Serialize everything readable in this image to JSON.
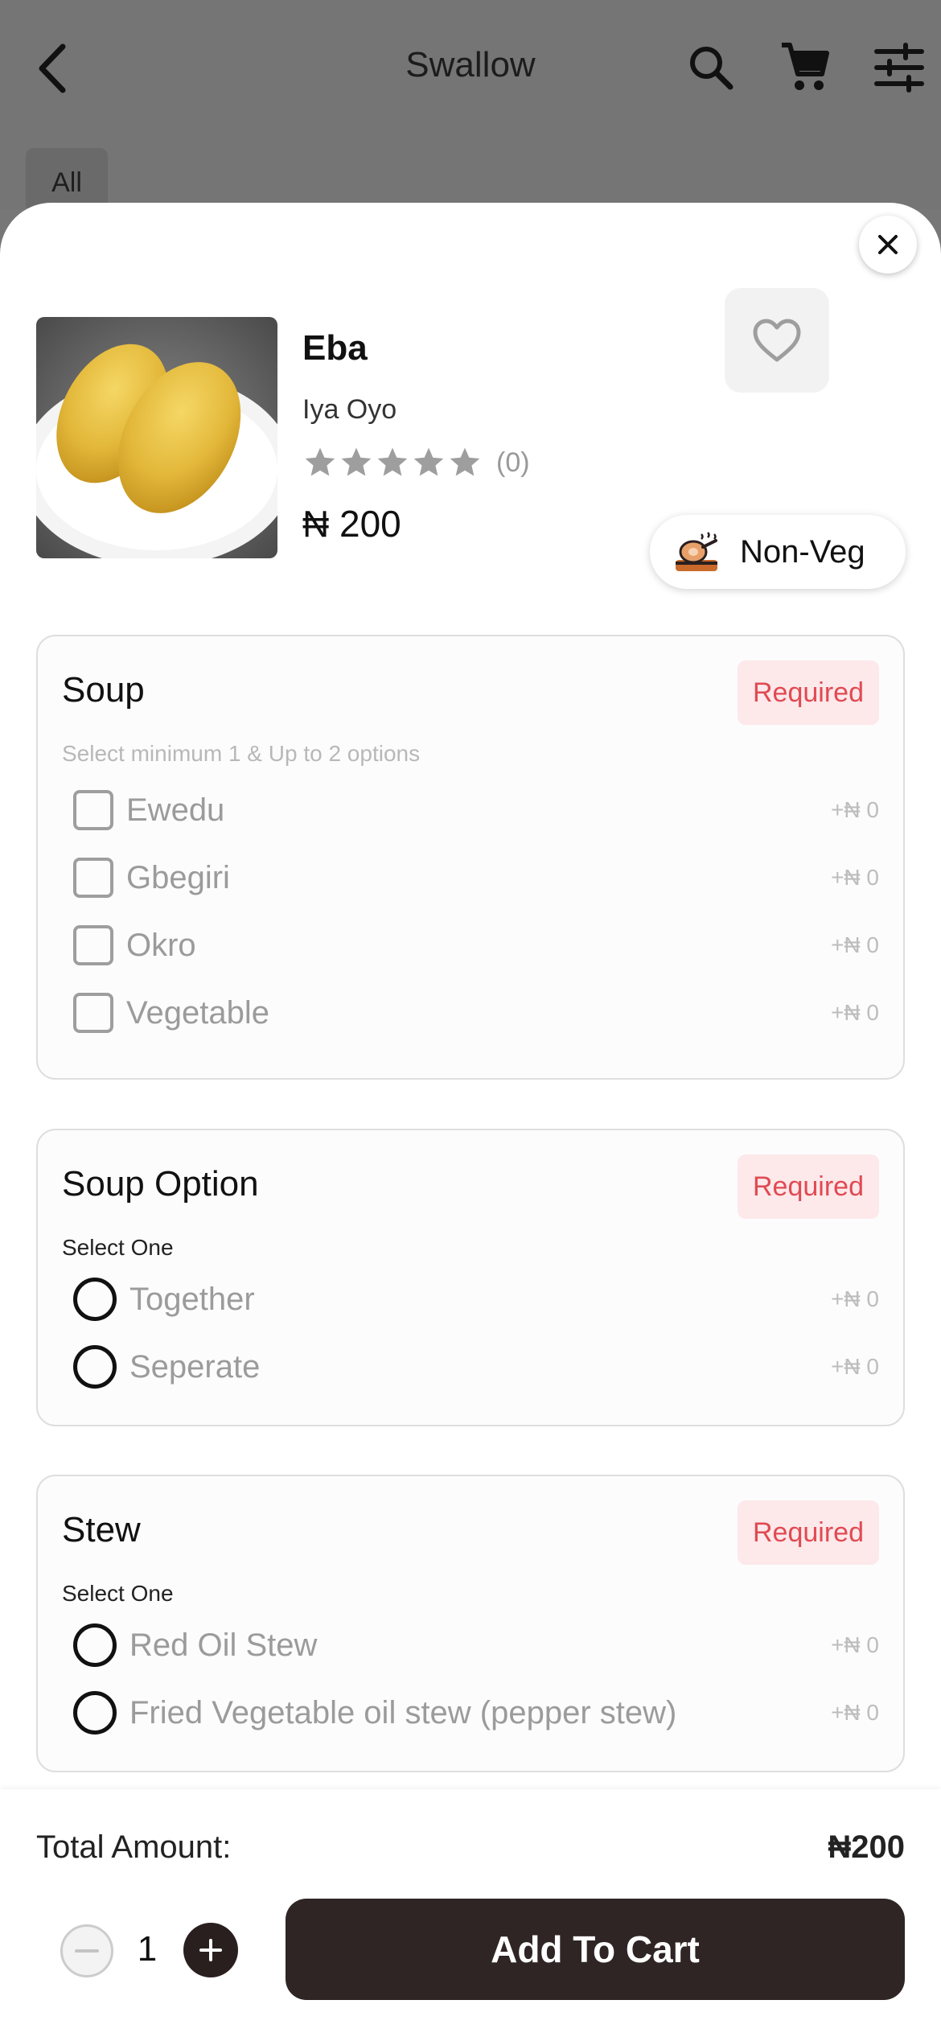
{
  "header": {
    "title": "Swallow",
    "back_icon": "back-arrow-icon",
    "search_icon": "search-icon",
    "cart_icon": "cart-icon",
    "filter_icon": "filter-sliders-icon"
  },
  "filters": {
    "all_label": "All"
  },
  "product": {
    "name": "Eba",
    "vendor": "Iya Oyo",
    "rating_stars": 0,
    "rating_count": "(0)",
    "price": "₦ 200",
    "diet_label": "Non-Veg",
    "favorite_icon": "heart-outline-icon",
    "close_icon": "close-icon"
  },
  "sections": [
    {
      "title": "Soup",
      "badge": "Required",
      "subtitle": "Select minimum 1 & Up to 2 options",
      "type": "checkbox",
      "options": [
        {
          "label": "Ewedu",
          "price": "+₦ 0"
        },
        {
          "label": "Gbegiri",
          "price": "+₦ 0"
        },
        {
          "label": "Okro",
          "price": "+₦ 0"
        },
        {
          "label": "Vegetable",
          "price": "+₦ 0"
        }
      ]
    },
    {
      "title": "Soup Option",
      "badge": "Required",
      "subtitle": "Select One",
      "type": "radio",
      "options": [
        {
          "label": "Together",
          "price": "+₦ 0"
        },
        {
          "label": "Seperate",
          "price": "+₦ 0"
        }
      ]
    },
    {
      "title": "Stew",
      "badge": "Required",
      "subtitle": "Select One",
      "type": "radio",
      "options": [
        {
          "label": "Red Oil Stew",
          "price": "+₦ 0"
        },
        {
          "label": "Fried Vegetable oil stew (pepper stew)",
          "price": "+₦ 0"
        }
      ]
    }
  ],
  "footer": {
    "total_label": "Total Amount:",
    "total_value": "₦200",
    "quantity": "1",
    "add_to_cart": "Add To Cart"
  },
  "colors": {
    "required_text": "#e04a52",
    "required_bg": "#fde8ea",
    "primary_button": "#2f2525"
  }
}
